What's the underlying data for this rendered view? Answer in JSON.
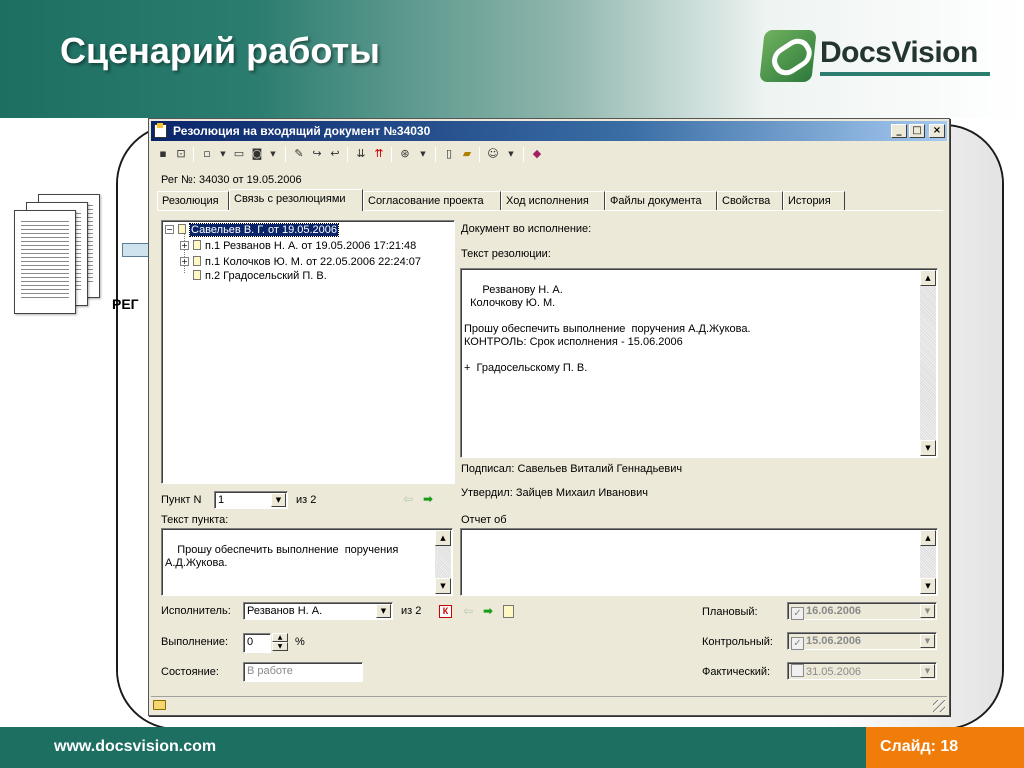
{
  "slide": {
    "title": "Сценарий работы",
    "logo_text": "DocsVision",
    "reg_label": "РЕГ",
    "footer_url": "www.docsvision.com",
    "slide_number": "Слайд: 18",
    "colors": {
      "header": "#1d6f62",
      "footer": "#1d6f62",
      "accent": "#f07c0a"
    }
  },
  "window": {
    "title": "Резолюция на входящий документ №34030",
    "controls": {
      "minimize": "_",
      "maximize": "□",
      "close": "×"
    }
  },
  "toolbar": {
    "icons": [
      "save-icon",
      "link-icon",
      "new-doc-icon",
      "dropdown-icon",
      "copy-icon",
      "preview-icon",
      "dropdown-icon",
      "sign-icon",
      "forward-icon",
      "back-icon",
      "import-icon",
      "export-icon",
      "stamp-icon",
      "dropdown-icon",
      "document-icon",
      "folder-icon",
      "users-icon",
      "dropdown-icon",
      "book-icon"
    ]
  },
  "reg_info": "Рег №: 34030 от 19.05.2006",
  "tabs": [
    {
      "label": "Резолюция",
      "active": false
    },
    {
      "label": "Связь с резолюциями",
      "active": true
    },
    {
      "label": "Согласование проекта",
      "active": false
    },
    {
      "label": "Ход исполнения",
      "active": false
    },
    {
      "label": "Файлы документа",
      "active": false
    },
    {
      "label": "Свойства",
      "active": false
    },
    {
      "label": "История",
      "active": false
    }
  ],
  "tree": {
    "root": "Савельев В. Г. от 19.05.2006",
    "children": [
      "п.1 Резванов Н. А. от 19.05.2006 17:21:48",
      "п.1 Колочков Ю. М. от 22.05.2006 22:24:07",
      "п.2 Градосельский П. В."
    ]
  },
  "right_panel": {
    "doc_for_execution_label": "Документ во исполнение:",
    "resolution_text_label": "Текст резолюции:",
    "resolution_text": "  Резванову Н. А.\n  Колочкову Ю. М.\n\nПрошу обеспечить выполнение  поручения А.Д.Жукова.\nКОНТРОЛЬ: Срок исполнения - 15.06.2006\n\n+  Градосельскому П. В.",
    "signed_by": "Подписал: Савельев Виталий Геннадьевич",
    "approved_by": "Утвердил: Зайцев Михаил Иванович",
    "report_label": "Отчет об"
  },
  "item": {
    "label": "Пункт N",
    "value": "1",
    "of_total": "из 2",
    "text_label": "Текст пункта:",
    "text": "Прошу обеспечить выполнение  поручения\nА.Д.Жукова."
  },
  "executor": {
    "label": "Исполнитель:",
    "value": "Резванов Н. А.",
    "of_total": "из 2",
    "remove_glyph": "К"
  },
  "execution": {
    "label": "Выполнение:",
    "value": "0",
    "unit": "%",
    "value_percent": 0
  },
  "state": {
    "label": "Состояние:",
    "value": "В работе"
  },
  "dates": {
    "planned_label": "Плановый:",
    "planned_value": "16.06.2006",
    "planned_checked": true,
    "control_label": "Контрольный:",
    "control_value": "15.06.2006",
    "control_checked": true,
    "actual_label": "Фактический:",
    "actual_value": "31.05.2006",
    "actual_checked": false
  },
  "glyphs": {
    "check": "✓",
    "expand": "+",
    "collapse": "−",
    "arrow_down": "▼",
    "arrow_up": "▲",
    "nav_prev": "⇦",
    "nav_next": "➡"
  }
}
